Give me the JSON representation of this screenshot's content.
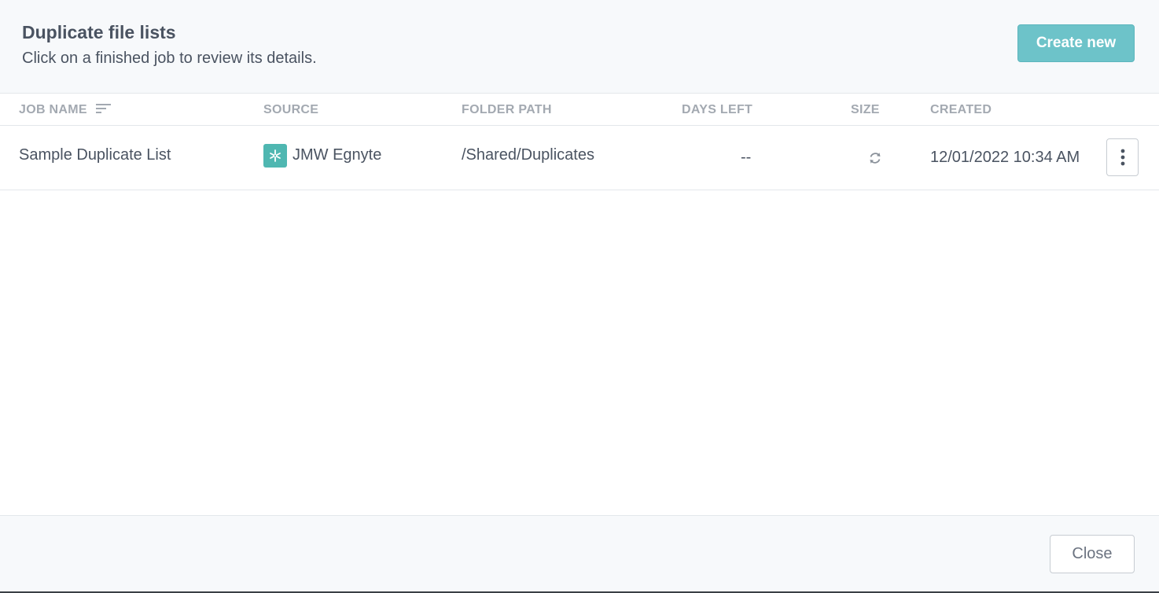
{
  "dialog": {
    "title": "Duplicate file lists",
    "subtitle": "Click on a finished job to review its details.",
    "create_button_label": "Create new",
    "close_button_label": "Close"
  },
  "table": {
    "columns": {
      "job_name": "JOB NAME",
      "source": "SOURCE",
      "folder_path": "FOLDER PATH",
      "days_left": "DAYS LEFT",
      "size": "SIZE",
      "created": "CREATED"
    },
    "rows": [
      {
        "job_name": "Sample Duplicate List",
        "source": "JMW Egnyte",
        "source_icon": "egnyte-icon",
        "folder_path": "/Shared/Duplicates",
        "days_left": "--",
        "size_icon": "refresh-icon",
        "created": "12/01/2022 10:34 AM"
      }
    ]
  },
  "colors": {
    "accent": "#6dc3c9",
    "source_icon_bg": "#4fb7b1",
    "header_text": "#a3a9b1",
    "body_text": "#4a5361"
  }
}
